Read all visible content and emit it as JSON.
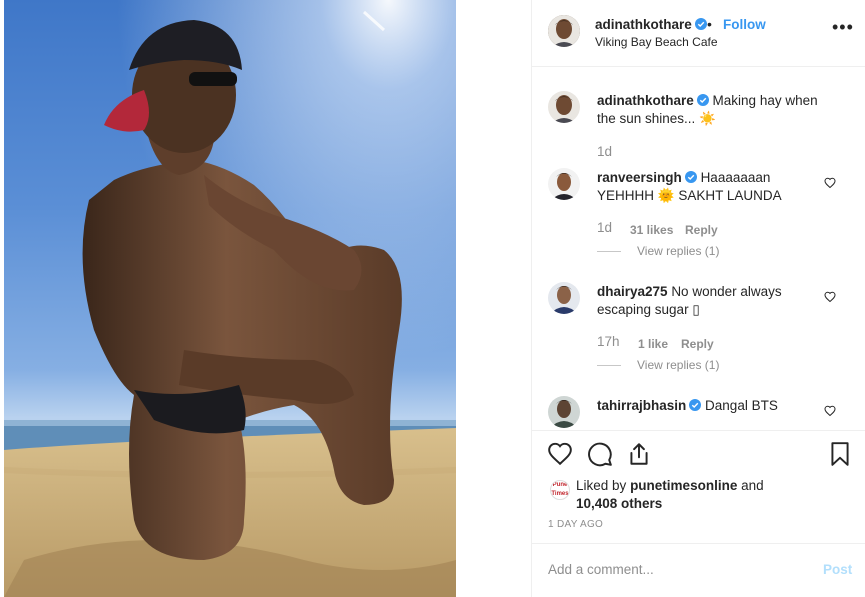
{
  "post": {
    "author": "adinathkothare",
    "follow_label": "Follow",
    "separator": "•",
    "location": "Viking Bay Beach Cafe",
    "more_label": "•••"
  },
  "caption": {
    "author": "adinathkothare",
    "text": "Making hay when the sun shines...",
    "emoji": "☀️",
    "age": "1d"
  },
  "comments": [
    {
      "author": "ranveersingh",
      "text_line1": "Haaaaaaan",
      "text_line2a": "YEHHHH",
      "emoji": "🌞",
      "text_line2b": "SAKHT LAUNDA",
      "age": "1d",
      "likes": "31 likes",
      "reply_label": "Reply",
      "view_replies": "View replies (1)"
    },
    {
      "author": "dhairya275",
      "text_line1": "No wonder always",
      "text_line2": "escaping sugar",
      "glyph": "▯",
      "age": "17h",
      "likes": "1 like",
      "reply_label": "Reply",
      "view_replies": "View replies (1)"
    },
    {
      "author": "tahirrajbhasin",
      "text_line1": "Dangal BTS"
    }
  ],
  "likes": {
    "prefix": "Liked by",
    "user": "punetimesonline",
    "and": "and",
    "others": "10,408 others",
    "avatar_text": "Pune Times"
  },
  "timestamp": "1 DAY AGO",
  "add_comment": {
    "placeholder": "Add a comment...",
    "post_label": "Post"
  },
  "icons": {
    "verified": "verified-badge-icon",
    "heart": "heart-icon",
    "comment": "comment-icon",
    "share": "share-icon",
    "bookmark": "bookmark-icon"
  },
  "colors": {
    "accent": "#3897f0",
    "verified": "#3897f0",
    "muted": "#8e8e8e",
    "post_disabled": "#b2dffc"
  }
}
